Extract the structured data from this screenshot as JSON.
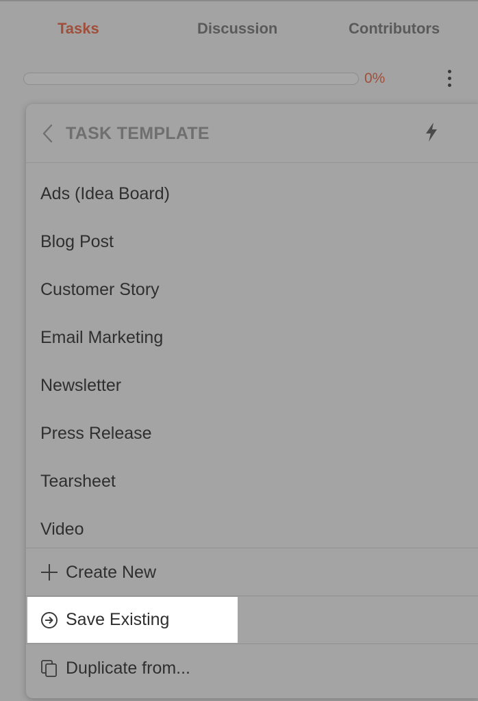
{
  "tabs": [
    {
      "label": "Tasks",
      "active": true
    },
    {
      "label": "Discussion",
      "active": false
    },
    {
      "label": "Contributors",
      "active": false
    }
  ],
  "progress": {
    "value": 0,
    "label": "0%"
  },
  "panel": {
    "title": "TASK TEMPLATE",
    "templates": [
      "Ads (Idea Board)",
      "Blog Post",
      "Customer Story",
      "Email Marketing",
      "Newsletter",
      "Press Release",
      "Tearsheet",
      "Video"
    ],
    "actions": {
      "create_new": "Create New",
      "save_existing": "Save Existing",
      "duplicate_from": "Duplicate from..."
    }
  },
  "colors": {
    "accent": "#a04f3a",
    "highlight": "#ffffff",
    "background": "#a3a3a3"
  },
  "icons": {
    "back": "chevron-left-icon",
    "quick": "lightning-bolt-icon",
    "more": "vertical-ellipsis-icon",
    "create": "plus-icon",
    "save": "arrow-right-circle-icon",
    "duplicate": "copy-icon"
  }
}
